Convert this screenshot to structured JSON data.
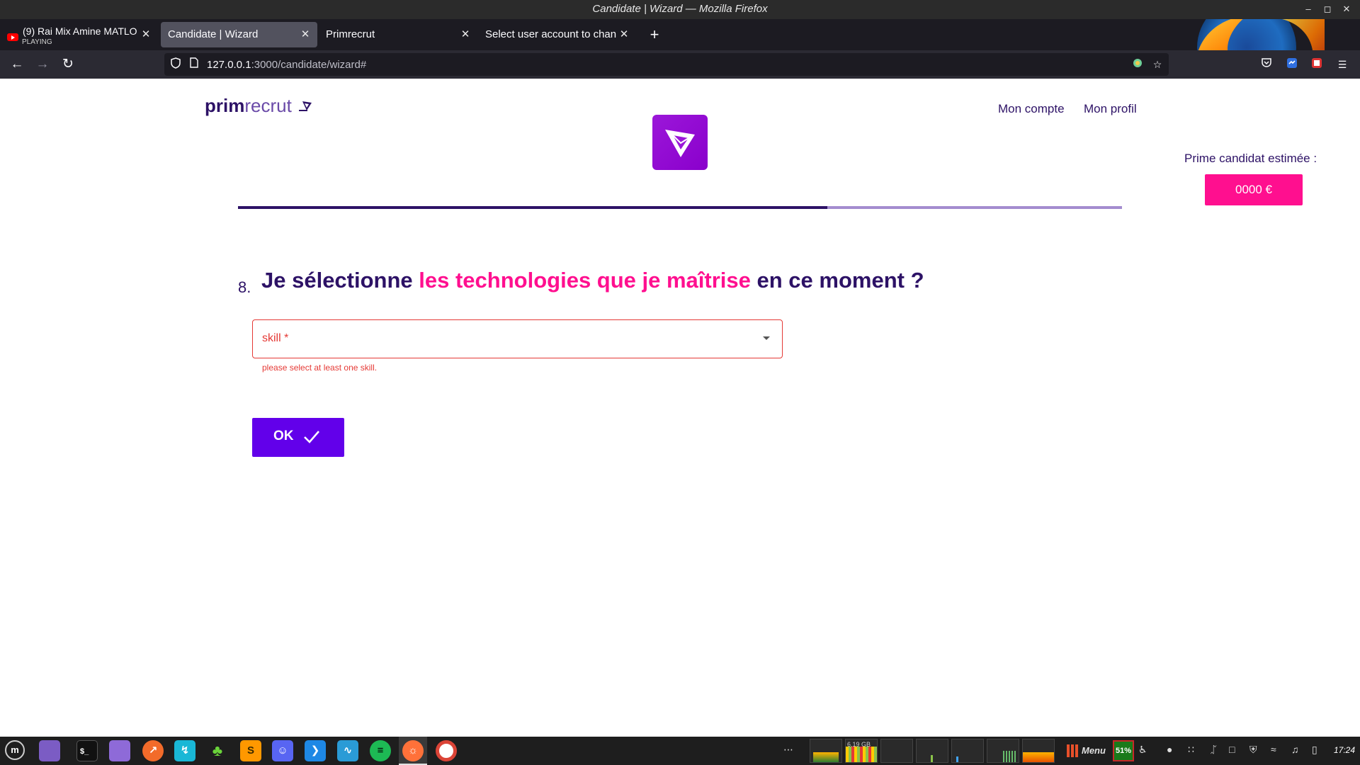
{
  "window": {
    "title": "Candidate | Wizard — Mozilla Firefox"
  },
  "tabs": [
    {
      "label": "(9) Rai Mix Amine MATLO",
      "sub": "PLAYING"
    },
    {
      "label": "Candidate | Wizard"
    },
    {
      "label": "Primrecrut"
    },
    {
      "label": "Select user account to chan"
    }
  ],
  "address": {
    "host": "127.0.0.1",
    "path": ":3000/candidate/wizard#"
  },
  "header": {
    "brand_bold": "prim",
    "brand_light": "recrut",
    "links": [
      "Mon compte",
      "Mon profil"
    ],
    "prime_label": "Prime candidat estimée :",
    "prime_value": "0000 €"
  },
  "progress": {
    "fraction": 0.667
  },
  "question": {
    "number": "8.",
    "part1": "Je sélectionne ",
    "highlight": "les technologies que je maîtrise",
    "part2": " en ce moment ?"
  },
  "skill_field": {
    "placeholder": "skill *",
    "error": "please select at least one skill."
  },
  "ok_button": {
    "label": "OK"
  },
  "taskbar": {
    "graphs": [
      "",
      "6.19 GB",
      "",
      "",
      "",
      "",
      ""
    ],
    "menu_label": "Menu",
    "battery": "51%",
    "clock": "17:24"
  },
  "colors": {
    "brand_dark": "#2d1266",
    "brand_pink": "#ff0f8f",
    "brand_purple": "#6200ea",
    "error": "#e53935"
  }
}
